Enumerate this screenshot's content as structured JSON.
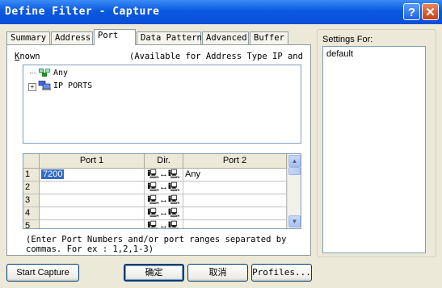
{
  "window": {
    "title": "Define Filter - Capture"
  },
  "tabs": [
    {
      "label": "Summary"
    },
    {
      "label": "Address"
    },
    {
      "label": "Port"
    },
    {
      "label": "Data Pattern"
    },
    {
      "label": "Advanced"
    },
    {
      "label": "Buffer"
    }
  ],
  "port_tab": {
    "known_label_underlined": "K",
    "known_label_rest": "nown",
    "avail_text": "(Available for Address Type IP and",
    "tree": [
      {
        "label": "Any",
        "icon": "network-icon"
      },
      {
        "label": "IP PORTS",
        "icon": "computers-icon",
        "expander": "+"
      }
    ],
    "grid": {
      "headers": [
        "Port 1",
        "Dir.",
        "Port 2"
      ],
      "rows": [
        {
          "num": "1",
          "port1": "7200",
          "dir": "🖳↔🖳",
          "port2": "Any"
        },
        {
          "num": "2",
          "port1": "",
          "dir": "🖳↔🖳",
          "port2": ""
        },
        {
          "num": "3",
          "port1": "",
          "dir": "🖳↔🖳",
          "port2": ""
        },
        {
          "num": "4",
          "port1": "",
          "dir": "🖳↔🖳",
          "port2": ""
        },
        {
          "num": "5",
          "port1": "",
          "dir": "🖳↔🖳",
          "port2": ""
        }
      ]
    },
    "note_line1": "(Enter Port Numbers and/or port ranges separated by",
    "note_line2": "commas. For ex : 1,2,1-3)"
  },
  "settings": {
    "label": "Settings For:",
    "items": [
      "default"
    ]
  },
  "buttons": {
    "start": "Start Capture",
    "ok": "确定",
    "cancel": "取消",
    "profiles": "Profiles..."
  },
  "colors": {
    "title_bar": "#0A58E0",
    "selection": "#316AC5",
    "face": "#ECE9D8"
  }
}
